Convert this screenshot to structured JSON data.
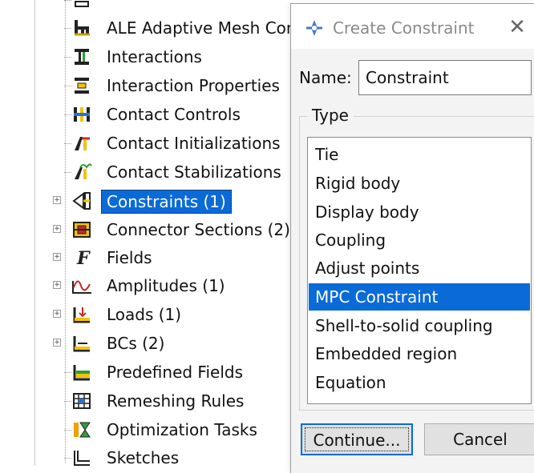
{
  "tree": {
    "items": [
      {
        "label": "ALE Adaptive Mesh Con",
        "icon": "ale-mesh-icon",
        "expandable": false,
        "selected": false
      },
      {
        "label": "Interactions",
        "icon": "interactions-icon",
        "expandable": false,
        "selected": false
      },
      {
        "label": "Interaction Properties",
        "icon": "interaction-properties-icon",
        "expandable": false,
        "selected": false
      },
      {
        "label": "Contact Controls",
        "icon": "contact-controls-icon",
        "expandable": false,
        "selected": false
      },
      {
        "label": "Contact Initializations",
        "icon": "contact-initializations-icon",
        "expandable": false,
        "selected": false
      },
      {
        "label": "Contact Stabilizations",
        "icon": "contact-stabilizations-icon",
        "expandable": false,
        "selected": false
      },
      {
        "label": "Constraints (1)",
        "icon": "constraints-icon",
        "expandable": true,
        "selected": true
      },
      {
        "label": "Connector Sections (2)",
        "icon": "connector-sections-icon",
        "expandable": true,
        "selected": false
      },
      {
        "label": "Fields",
        "icon": "fields-icon",
        "expandable": true,
        "selected": false
      },
      {
        "label": "Amplitudes (1)",
        "icon": "amplitudes-icon",
        "expandable": true,
        "selected": false
      },
      {
        "label": "Loads (1)",
        "icon": "loads-icon",
        "expandable": true,
        "selected": false
      },
      {
        "label": "BCs (2)",
        "icon": "bcs-icon",
        "expandable": true,
        "selected": false
      },
      {
        "label": "Predefined Fields",
        "icon": "predefined-fields-icon",
        "expandable": false,
        "selected": false
      },
      {
        "label": "Remeshing Rules",
        "icon": "remeshing-rules-icon",
        "expandable": false,
        "selected": false
      },
      {
        "label": "Optimization Tasks",
        "icon": "optimization-tasks-icon",
        "expandable": false,
        "selected": false
      },
      {
        "label": "Sketches",
        "icon": "sketches-icon",
        "expandable": false,
        "selected": false
      }
    ],
    "expander_symbol": "+"
  },
  "dialog": {
    "title": "Create Constraint",
    "title_icon": "constraint-icon",
    "close_symbol": "✕",
    "name_label": "Name:",
    "name_value": "Constraint",
    "type_group_title": "Type",
    "type_options": [
      {
        "label": "Tie",
        "selected": false
      },
      {
        "label": "Rigid body",
        "selected": false
      },
      {
        "label": "Display body",
        "selected": false
      },
      {
        "label": "Coupling",
        "selected": false
      },
      {
        "label": "Adjust points",
        "selected": false
      },
      {
        "label": "MPC Constraint",
        "selected": true
      },
      {
        "label": "Shell-to-solid coupling",
        "selected": false
      },
      {
        "label": "Embedded region",
        "selected": false
      },
      {
        "label": "Equation",
        "selected": false
      }
    ],
    "continue_label": "Continue...",
    "cancel_label": "Cancel"
  },
  "colors": {
    "selection": "#0a6ad8",
    "dialog_background": "#f3f3f3",
    "title_text": "#8a8a8a"
  }
}
